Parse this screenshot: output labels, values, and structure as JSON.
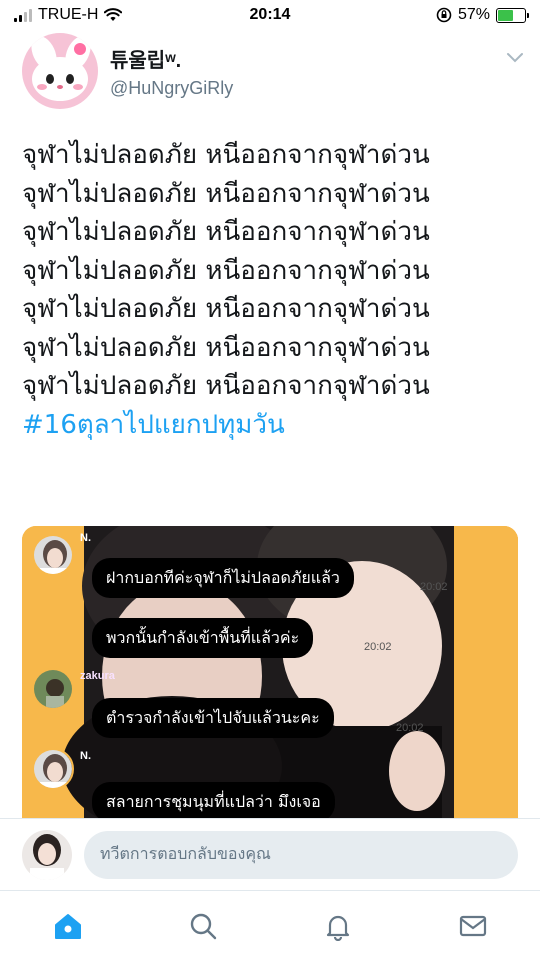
{
  "status_bar": {
    "carrier": "TRUE-H",
    "time": "20:14",
    "battery_percent": "57%",
    "battery_level": 0.57,
    "icons": [
      "signal-icon",
      "wifi-icon",
      "orientation-lock-icon",
      "battery-icon"
    ]
  },
  "tweet": {
    "display_name": "튜울립ʷ.",
    "handle": "@HuNgryGiRly",
    "lines": [
      "จุฬาไม่ปลอดภัย หนีออกจากจุฬาด่วน",
      "จุฬาไม่ปลอดภัย หนีออกจากจุฬาด่วน",
      "จุฬาไม่ปลอดภัย หนีออกจากจุฬาด่วน",
      "จุฬาไม่ปลอดภัย หนีออกจากจุฬาด่วน",
      "จุฬาไม่ปลอดภัย หนีออกจากจุฬาด่วน",
      "จุฬาไม่ปลอดภัย หนีออกจากจุฬาด่วน",
      "จุฬาไม่ปลอดภัย หนีออกจากจุฬาด่วน"
    ],
    "hashtag": "#16ตุลาไปแยกปทุมวัน"
  },
  "media": {
    "chat": [
      {
        "name": "N.",
        "text": "ฝากบอกทีค่ะจุฬาก็ไม่ปลอดภัยแล้ว",
        "time": "20:02"
      },
      {
        "name": "",
        "text": "พวกนั้นกำลังเข้าพื้นที่แล้วค่ะ",
        "time": "20:02"
      },
      {
        "name": "zakura",
        "text": "ตำรวจกำลังเข้าไปจับแล้วนะคะ",
        "time": "20:02"
      },
      {
        "name": "N.",
        "text": "สลายการชุมนุมที่แปลว่า มึงเจอ",
        "time": ""
      }
    ]
  },
  "reply": {
    "placeholder": "ทวีตการตอบกลับของคุณ"
  },
  "tab_bar": {
    "tabs": [
      "home-icon",
      "search-icon",
      "notifications-icon",
      "messages-icon"
    ],
    "active": "home-icon"
  },
  "colors": {
    "accent": "#1da1f2",
    "media_background": "#f7b84b",
    "bubble": "#000000"
  }
}
